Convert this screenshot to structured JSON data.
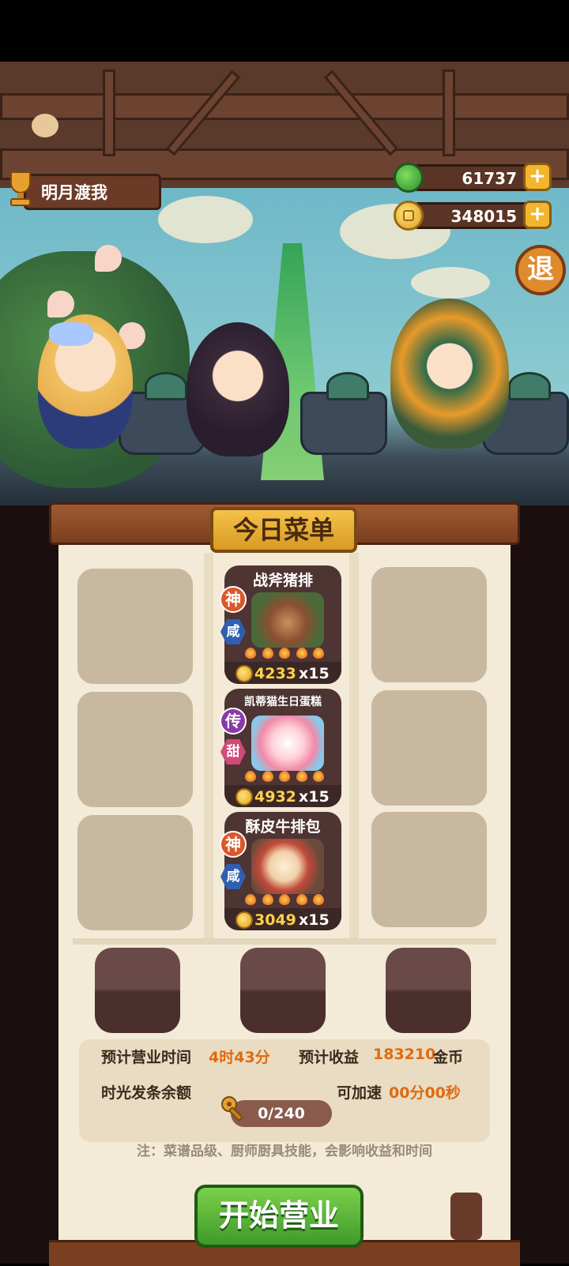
{
  "player": {
    "name": "明月渡我"
  },
  "currency": {
    "jade": {
      "value": "61737",
      "icon": "jade-icon",
      "plus": "+"
    },
    "coins": {
      "value": "348015",
      "icon": "coin-icon",
      "plus": "+"
    }
  },
  "exit_label": "退",
  "menu": {
    "title": "今日菜单",
    "dishes": [
      {
        "name": "战斧猪排",
        "grade": "神",
        "flavor": "咸",
        "price": "4233",
        "qty": "x15",
        "flames": 5,
        "grade_color": "#d9572a",
        "flavor_color": "#2f5fb0"
      },
      {
        "name": "凯蒂猫生日蛋糕",
        "grade": "传",
        "flavor": "甜",
        "price": "4932",
        "qty": "x15",
        "flames": 5,
        "grade_color": "#8a3aa8",
        "flavor_color": "#d04a7a"
      },
      {
        "name": "酥皮牛排包",
        "grade": "神",
        "flavor": "咸",
        "price": "3049",
        "qty": "x15",
        "flames": 5,
        "grade_color": "#d9572a",
        "flavor_color": "#2f5fb0"
      }
    ]
  },
  "info": {
    "time_label": "预计营业时间",
    "time_value": "4时43分",
    "income_label": "预计收益",
    "income_value": "183210",
    "income_unit": "金币",
    "spring_label": "时光发条余额",
    "spring_progress": "0/240",
    "speed_label": "可加速",
    "speed_value": "00分00秒",
    "note": "注：菜谱品级、厨师厨具技能，会影响收益和时间"
  },
  "start_button": "开始营业"
}
